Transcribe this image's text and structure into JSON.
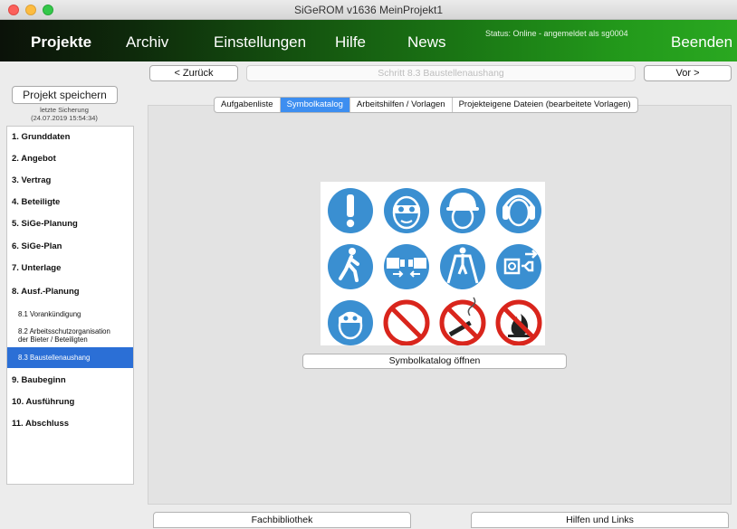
{
  "window": {
    "title": "SiGeROM  v1636   MeinProjekt1"
  },
  "nav": {
    "projekte": "Projekte",
    "archiv": "Archiv",
    "einstellungen": "Einstellungen",
    "hilfe": "Hilfe",
    "news": "News",
    "beenden": "Beenden",
    "status": "Status: Online - angemeldet als sg0004"
  },
  "sidebar": {
    "save_label": "Projekt speichern",
    "last_save_label": "letzte Sicherung",
    "last_save_time": "(24.07.2019 15:54:34)",
    "items": [
      {
        "label": "1.  Grunddaten"
      },
      {
        "label": "2.  Angebot"
      },
      {
        "label": "3.  Vertrag"
      },
      {
        "label": "4.  Beteiligte"
      },
      {
        "label": "5.  SiGe-Planung"
      },
      {
        "label": "6.  SiGe-Plan"
      },
      {
        "label": "7.  Unterlage"
      },
      {
        "label": "8.  Ausf.-Planung"
      }
    ],
    "subitems": [
      {
        "label": "8.1 Vorankündigung"
      },
      {
        "label": "8.2 Arbeitsschutzorganisation",
        "label2": "der Bieter / Beteiligten"
      },
      {
        "label": "8.3 Baustellenaushang"
      }
    ],
    "items2": [
      {
        "label": "9.  Baubeginn"
      },
      {
        "label": "10. Ausführung"
      },
      {
        "label": "11. Abschluss"
      }
    ]
  },
  "toolbar": {
    "back_label": "< Zurück",
    "step_label": "Schritt 8.3  Baustellenaushang",
    "forward_label": "Vor >"
  },
  "tabs": [
    {
      "label": "Aufgabenliste"
    },
    {
      "label": "Symbolkatalog"
    },
    {
      "label": "Arbeitshilfen / Vorlagen"
    },
    {
      "label": "Projekteigene Dateien (bearbeitete Vorlagen)"
    }
  ],
  "main": {
    "symbols": [
      "general-warning-icon",
      "eye-protection-icon",
      "head-protection-icon",
      "hearing-protection-icon",
      "pedestrian-route-icon",
      "use-seatbelt-icon",
      "use-walkway-icon",
      "disconnect-plug-icon",
      "face-shield-icon",
      "general-prohibition-icon",
      "no-smoking-icon",
      "no-open-flame-icon"
    ],
    "open_catalog_label": "Symbolkatalog öffnen"
  },
  "footer": {
    "library_label": "Fachbibliothek",
    "help_links_label": "Hilfen und Links"
  },
  "colors": {
    "mandatory_blue": "#3a8fd1",
    "prohibition_red": "#d9251c",
    "active_blue": "#2b6fd6",
    "nav_green": "#239a1b"
  }
}
